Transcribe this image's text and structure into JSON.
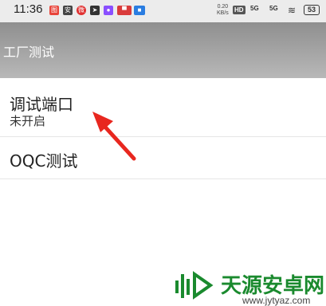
{
  "status_bar": {
    "time": "11:36",
    "speed_value": "0.20",
    "speed_unit": "KB/s",
    "hd_badge": "HD",
    "net1": "5G",
    "net2": "5G",
    "battery": "53",
    "icon_colors": [
      "#e8443a",
      "#444444",
      "#e03030",
      "#333333",
      "#8a4fff",
      "#d93b3b",
      "#2a7de1"
    ]
  },
  "app_bar": {
    "title": "工厂测试"
  },
  "list": [
    {
      "title": "调试端口",
      "subtitle": "未开启"
    },
    {
      "title": "OQC测试"
    }
  ],
  "watermark": {
    "title": "天源安卓网",
    "url": "www.jytyaz.com"
  }
}
